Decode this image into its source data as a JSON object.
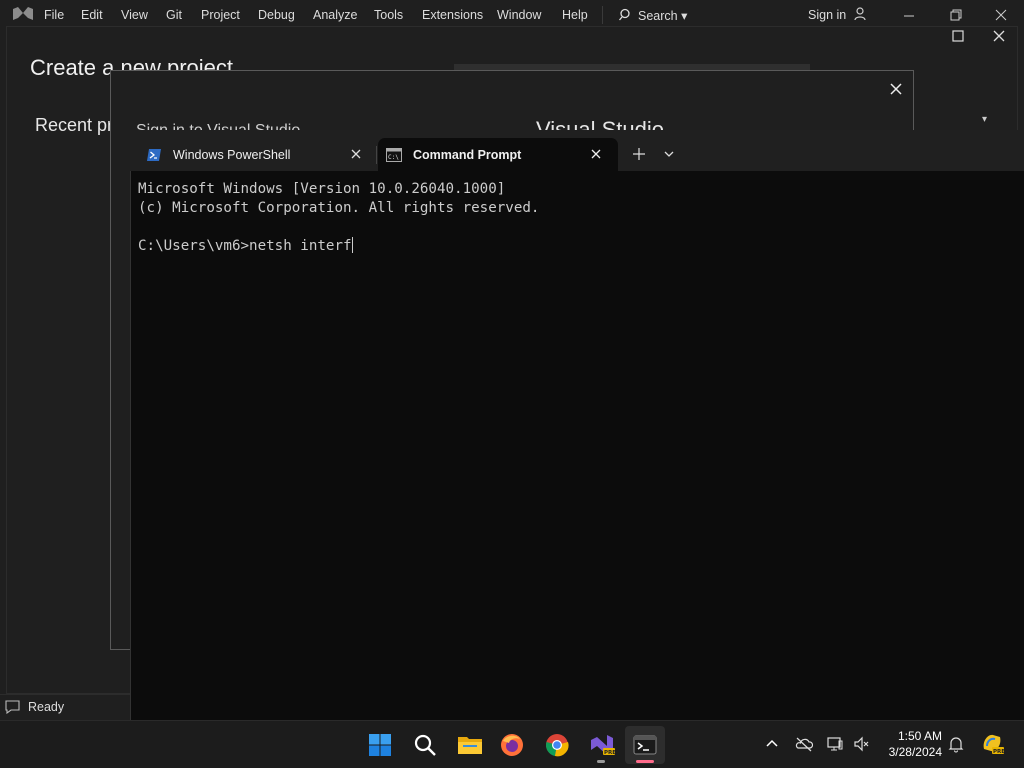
{
  "visual_studio": {
    "menus": [
      "File",
      "Edit",
      "View",
      "Git",
      "Project",
      "Debug",
      "Analyze",
      "Tools",
      "Extensions",
      "Window",
      "Help"
    ],
    "search_label": "Search ▾",
    "signin_label": "Sign in",
    "page_title": "Create a new project",
    "recent_title": "Recent pr",
    "dialog_text_left": "Sign in to Visual Studio",
    "dialog_text_right": "Visual Studio",
    "status": "Ready"
  },
  "terminal": {
    "tabs": [
      {
        "label": "Windows PowerShell",
        "icon": "powershell-icon"
      },
      {
        "label": "Command Prompt",
        "icon": "cmd-icon",
        "active": true
      }
    ],
    "lines": [
      "Microsoft Windows [Version 10.0.26040.1000]",
      "(c) Microsoft Corporation. All rights reserved.",
      "",
      "C:\\Users\\vm6>netsh interf"
    ],
    "colors": {
      "background": "#0c0c0c",
      "text": "#cccccc",
      "tabbar": "#202020"
    }
  },
  "taskbar": {
    "apps": [
      "windows-start-icon",
      "search-icon",
      "file-explorer-icon",
      "firefox-icon",
      "chrome-icon",
      "visual-studio-preview-icon",
      "terminal-icon"
    ],
    "clock_time": "1:50 AM",
    "clock_date": "3/28/2024",
    "tray_icons": [
      "chevron-up-icon",
      "onedrive-icon",
      "display-icon",
      "volume-muted-icon",
      "notification-bell-icon",
      "copilot-preview-icon"
    ],
    "accent": "#0078d4"
  }
}
